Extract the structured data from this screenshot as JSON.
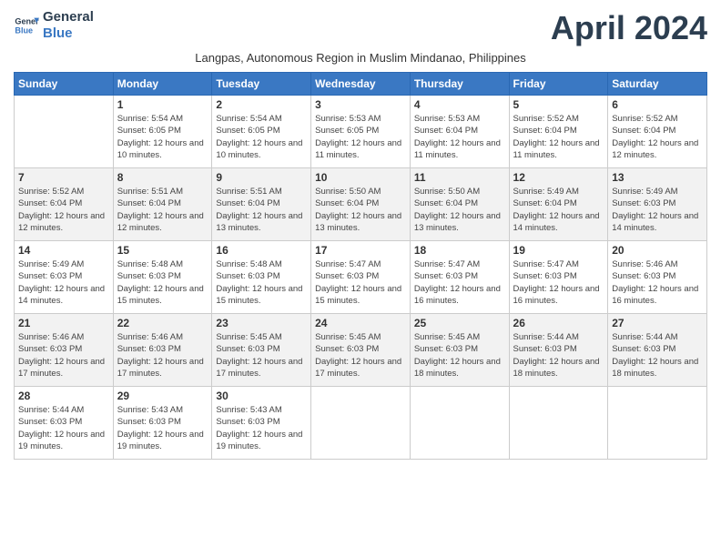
{
  "logo": {
    "line1": "General",
    "line2": "Blue",
    "icon_color": "#3a78c3"
  },
  "title": "April 2024",
  "subtitle": "Langpas, Autonomous Region in Muslim Mindanao, Philippines",
  "days_of_week": [
    "Sunday",
    "Monday",
    "Tuesday",
    "Wednesday",
    "Thursday",
    "Friday",
    "Saturday"
  ],
  "weeks": [
    [
      {
        "day": "",
        "empty": true
      },
      {
        "day": "1",
        "sunrise": "5:54 AM",
        "sunset": "6:05 PM",
        "daylight": "12 hours and 10 minutes."
      },
      {
        "day": "2",
        "sunrise": "5:54 AM",
        "sunset": "6:05 PM",
        "daylight": "12 hours and 10 minutes."
      },
      {
        "day": "3",
        "sunrise": "5:53 AM",
        "sunset": "6:05 PM",
        "daylight": "12 hours and 11 minutes."
      },
      {
        "day": "4",
        "sunrise": "5:53 AM",
        "sunset": "6:04 PM",
        "daylight": "12 hours and 11 minutes."
      },
      {
        "day": "5",
        "sunrise": "5:52 AM",
        "sunset": "6:04 PM",
        "daylight": "12 hours and 11 minutes."
      },
      {
        "day": "6",
        "sunrise": "5:52 AM",
        "sunset": "6:04 PM",
        "daylight": "12 hours and 12 minutes."
      }
    ],
    [
      {
        "day": "7",
        "sunrise": "5:52 AM",
        "sunset": "6:04 PM",
        "daylight": "12 hours and 12 minutes."
      },
      {
        "day": "8",
        "sunrise": "5:51 AM",
        "sunset": "6:04 PM",
        "daylight": "12 hours and 12 minutes."
      },
      {
        "day": "9",
        "sunrise": "5:51 AM",
        "sunset": "6:04 PM",
        "daylight": "12 hours and 13 minutes."
      },
      {
        "day": "10",
        "sunrise": "5:50 AM",
        "sunset": "6:04 PM",
        "daylight": "12 hours and 13 minutes."
      },
      {
        "day": "11",
        "sunrise": "5:50 AM",
        "sunset": "6:04 PM",
        "daylight": "12 hours and 13 minutes."
      },
      {
        "day": "12",
        "sunrise": "5:49 AM",
        "sunset": "6:04 PM",
        "daylight": "12 hours and 14 minutes."
      },
      {
        "day": "13",
        "sunrise": "5:49 AM",
        "sunset": "6:03 PM",
        "daylight": "12 hours and 14 minutes."
      }
    ],
    [
      {
        "day": "14",
        "sunrise": "5:49 AM",
        "sunset": "6:03 PM",
        "daylight": "12 hours and 14 minutes."
      },
      {
        "day": "15",
        "sunrise": "5:48 AM",
        "sunset": "6:03 PM",
        "daylight": "12 hours and 15 minutes."
      },
      {
        "day": "16",
        "sunrise": "5:48 AM",
        "sunset": "6:03 PM",
        "daylight": "12 hours and 15 minutes."
      },
      {
        "day": "17",
        "sunrise": "5:47 AM",
        "sunset": "6:03 PM",
        "daylight": "12 hours and 15 minutes."
      },
      {
        "day": "18",
        "sunrise": "5:47 AM",
        "sunset": "6:03 PM",
        "daylight": "12 hours and 16 minutes."
      },
      {
        "day": "19",
        "sunrise": "5:47 AM",
        "sunset": "6:03 PM",
        "daylight": "12 hours and 16 minutes."
      },
      {
        "day": "20",
        "sunrise": "5:46 AM",
        "sunset": "6:03 PM",
        "daylight": "12 hours and 16 minutes."
      }
    ],
    [
      {
        "day": "21",
        "sunrise": "5:46 AM",
        "sunset": "6:03 PM",
        "daylight": "12 hours and 17 minutes."
      },
      {
        "day": "22",
        "sunrise": "5:46 AM",
        "sunset": "6:03 PM",
        "daylight": "12 hours and 17 minutes."
      },
      {
        "day": "23",
        "sunrise": "5:45 AM",
        "sunset": "6:03 PM",
        "daylight": "12 hours and 17 minutes."
      },
      {
        "day": "24",
        "sunrise": "5:45 AM",
        "sunset": "6:03 PM",
        "daylight": "12 hours and 17 minutes."
      },
      {
        "day": "25",
        "sunrise": "5:45 AM",
        "sunset": "6:03 PM",
        "daylight": "12 hours and 18 minutes."
      },
      {
        "day": "26",
        "sunrise": "5:44 AM",
        "sunset": "6:03 PM",
        "daylight": "12 hours and 18 minutes."
      },
      {
        "day": "27",
        "sunrise": "5:44 AM",
        "sunset": "6:03 PM",
        "daylight": "12 hours and 18 minutes."
      }
    ],
    [
      {
        "day": "28",
        "sunrise": "5:44 AM",
        "sunset": "6:03 PM",
        "daylight": "12 hours and 19 minutes."
      },
      {
        "day": "29",
        "sunrise": "5:43 AM",
        "sunset": "6:03 PM",
        "daylight": "12 hours and 19 minutes."
      },
      {
        "day": "30",
        "sunrise": "5:43 AM",
        "sunset": "6:03 PM",
        "daylight": "12 hours and 19 minutes."
      },
      {
        "day": "",
        "empty": true
      },
      {
        "day": "",
        "empty": true
      },
      {
        "day": "",
        "empty": true
      },
      {
        "day": "",
        "empty": true
      }
    ]
  ]
}
